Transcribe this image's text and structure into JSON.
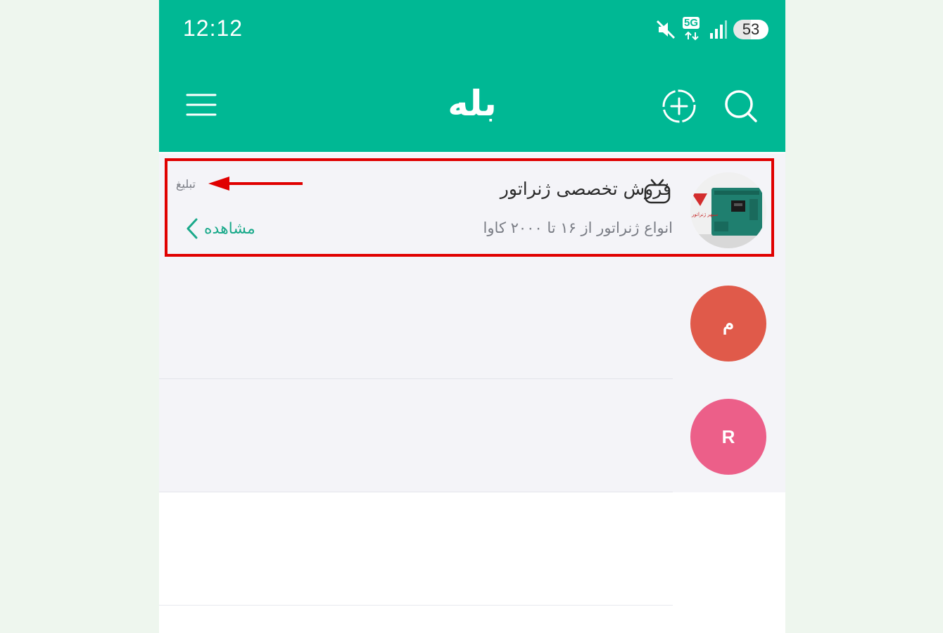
{
  "status_bar": {
    "time": "12:12",
    "network": "5G",
    "battery": "53",
    "icons": [
      "mute-icon",
      "5g-icon",
      "signal-icon",
      "battery-icon"
    ]
  },
  "app_bar": {
    "logo": "بله",
    "icons": [
      "menu-icon",
      "add-story-icon",
      "search-icon"
    ],
    "color": "#00b894"
  },
  "ad": {
    "title": "فروش تخصصی ژنراتور",
    "subtitle": "انواع ژنراتور از ۱۶ تا ۲۰۰۰ کاوا",
    "tag": "تبلیغ",
    "view_label": "مشاهده",
    "avatar_text": "سپهر ژنراتور"
  },
  "chats": [
    {
      "avatar_letter": "م",
      "avatar_color": "#e05a4a"
    },
    {
      "avatar_letter": "R",
      "avatar_color": "#ec5f89"
    }
  ],
  "annotation_color": "#e00000"
}
